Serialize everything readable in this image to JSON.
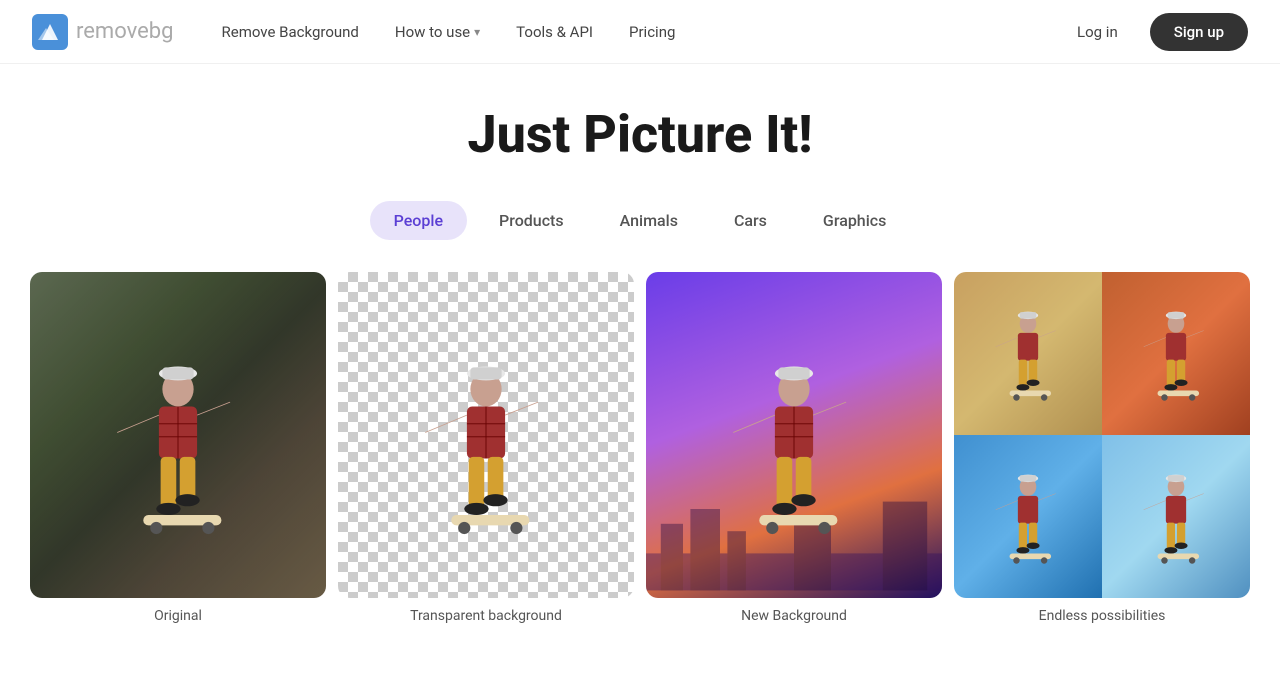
{
  "brand": {
    "logo_text_main": "remove",
    "logo_text_accent": "bg",
    "logo_alt": "remove.bg logo"
  },
  "nav": {
    "links": [
      {
        "id": "remove-background",
        "label": "Remove Background",
        "has_dropdown": false
      },
      {
        "id": "how-to-use",
        "label": "How to use",
        "has_dropdown": true
      },
      {
        "id": "tools-api",
        "label": "Tools & API",
        "has_dropdown": false
      },
      {
        "id": "pricing",
        "label": "Pricing",
        "has_dropdown": false
      }
    ],
    "login_label": "Log in",
    "signup_label": "Sign up"
  },
  "hero": {
    "title": "Just Picture It!"
  },
  "categories": {
    "tabs": [
      {
        "id": "people",
        "label": "People",
        "active": true
      },
      {
        "id": "products",
        "label": "Products",
        "active": false
      },
      {
        "id": "animals",
        "label": "Animals",
        "active": false
      },
      {
        "id": "cars",
        "label": "Cars",
        "active": false
      },
      {
        "id": "graphics",
        "label": "Graphics",
        "active": false
      }
    ]
  },
  "showcase": {
    "images": [
      {
        "id": "original",
        "type": "original",
        "label": "Original"
      },
      {
        "id": "transparent",
        "type": "transparent",
        "label": "Transparent background"
      },
      {
        "id": "new-bg",
        "type": "new-bg",
        "label": "New Background"
      },
      {
        "id": "endless",
        "type": "endless",
        "label": "Endless possibilities"
      }
    ]
  },
  "colors": {
    "tab_active_bg": "#e8e3fa",
    "tab_active_text": "#5b3fd4",
    "signup_bg": "#333333"
  }
}
